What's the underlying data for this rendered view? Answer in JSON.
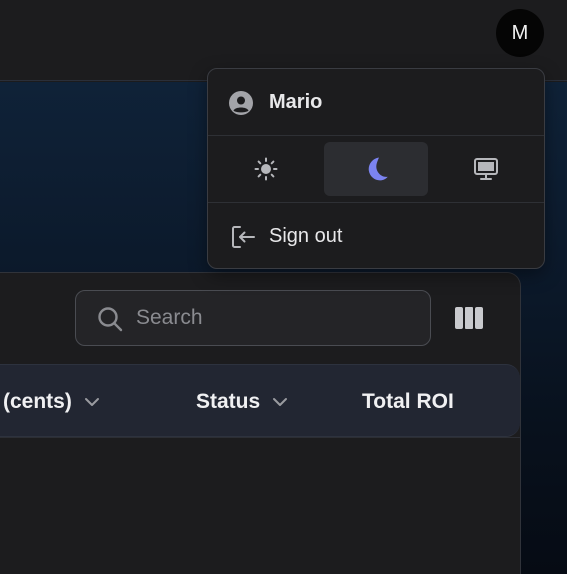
{
  "header": {
    "avatar_initial": "M"
  },
  "user_menu": {
    "user_name": "Mario",
    "theme_options": [
      {
        "name": "light",
        "icon": "sun-icon",
        "selected": false
      },
      {
        "name": "dark",
        "icon": "moon-icon",
        "selected": true
      },
      {
        "name": "system",
        "icon": "monitor-icon",
        "selected": false
      }
    ],
    "sign_out_label": "Sign out",
    "accent_color": "#7b83f0"
  },
  "toolbar": {
    "search_placeholder": "Search",
    "columns_icon": "columns-icon"
  },
  "table": {
    "columns": [
      {
        "label": "(cents)",
        "sortable": true
      },
      {
        "label": "Status",
        "sortable": true
      },
      {
        "label": "Total ROI",
        "sortable": false
      }
    ]
  }
}
